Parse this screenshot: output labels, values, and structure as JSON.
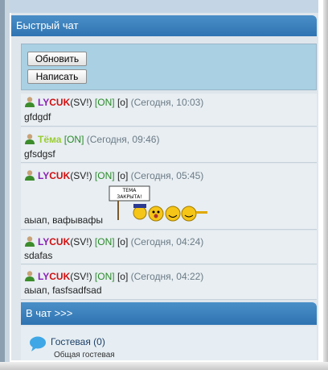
{
  "chat": {
    "title": "Быстрый чат",
    "buttons": {
      "refresh": "Обновить",
      "write": "Написать"
    },
    "messages": [
      {
        "nick_a": "LY",
        "nick_b": "CUK",
        "suffix": "(SV!)",
        "status": "[ON]",
        "o": "[o]",
        "time": "(Сегодня, 10:03)",
        "text": "gfdgdf"
      },
      {
        "nick": "Тёма",
        "status": "[ON]",
        "time": "(Сегодня, 09:46)",
        "text": "gfsdgsf"
      },
      {
        "nick_a": "LY",
        "nick_b": "CUK",
        "suffix": "(SV!)",
        "status": "[ON]",
        "o": "[o]",
        "time": "(Сегодня, 05:45)",
        "sign_text": "ТЕМА ЗАКРЫТА!",
        "text": "аыап, вафывафы"
      },
      {
        "nick_a": "LY",
        "nick_b": "CUK",
        "suffix": "(SV!)",
        "status": "[ON]",
        "o": "[o]",
        "time": "(Сегодня, 04:24)",
        "text": "sdafas"
      },
      {
        "nick_a": "LY",
        "nick_b": "CUK",
        "suffix": "(SV!)",
        "status": "[ON]",
        "o": "[o]",
        "time": "(Сегодня, 04:22)",
        "text": "аыап, fasfsadfsad"
      }
    ]
  },
  "footer": {
    "label": "В чат >>>"
  },
  "forum": {
    "title": "Гостевая (0)",
    "description": "Общая гостевая"
  },
  "colors": {
    "nick_a": "#8a1fb8",
    "nick_b": "#d01010",
    "nick_tema": "#9acd32",
    "header": "#3a80bd",
    "status_on": "#2a8a2a"
  }
}
